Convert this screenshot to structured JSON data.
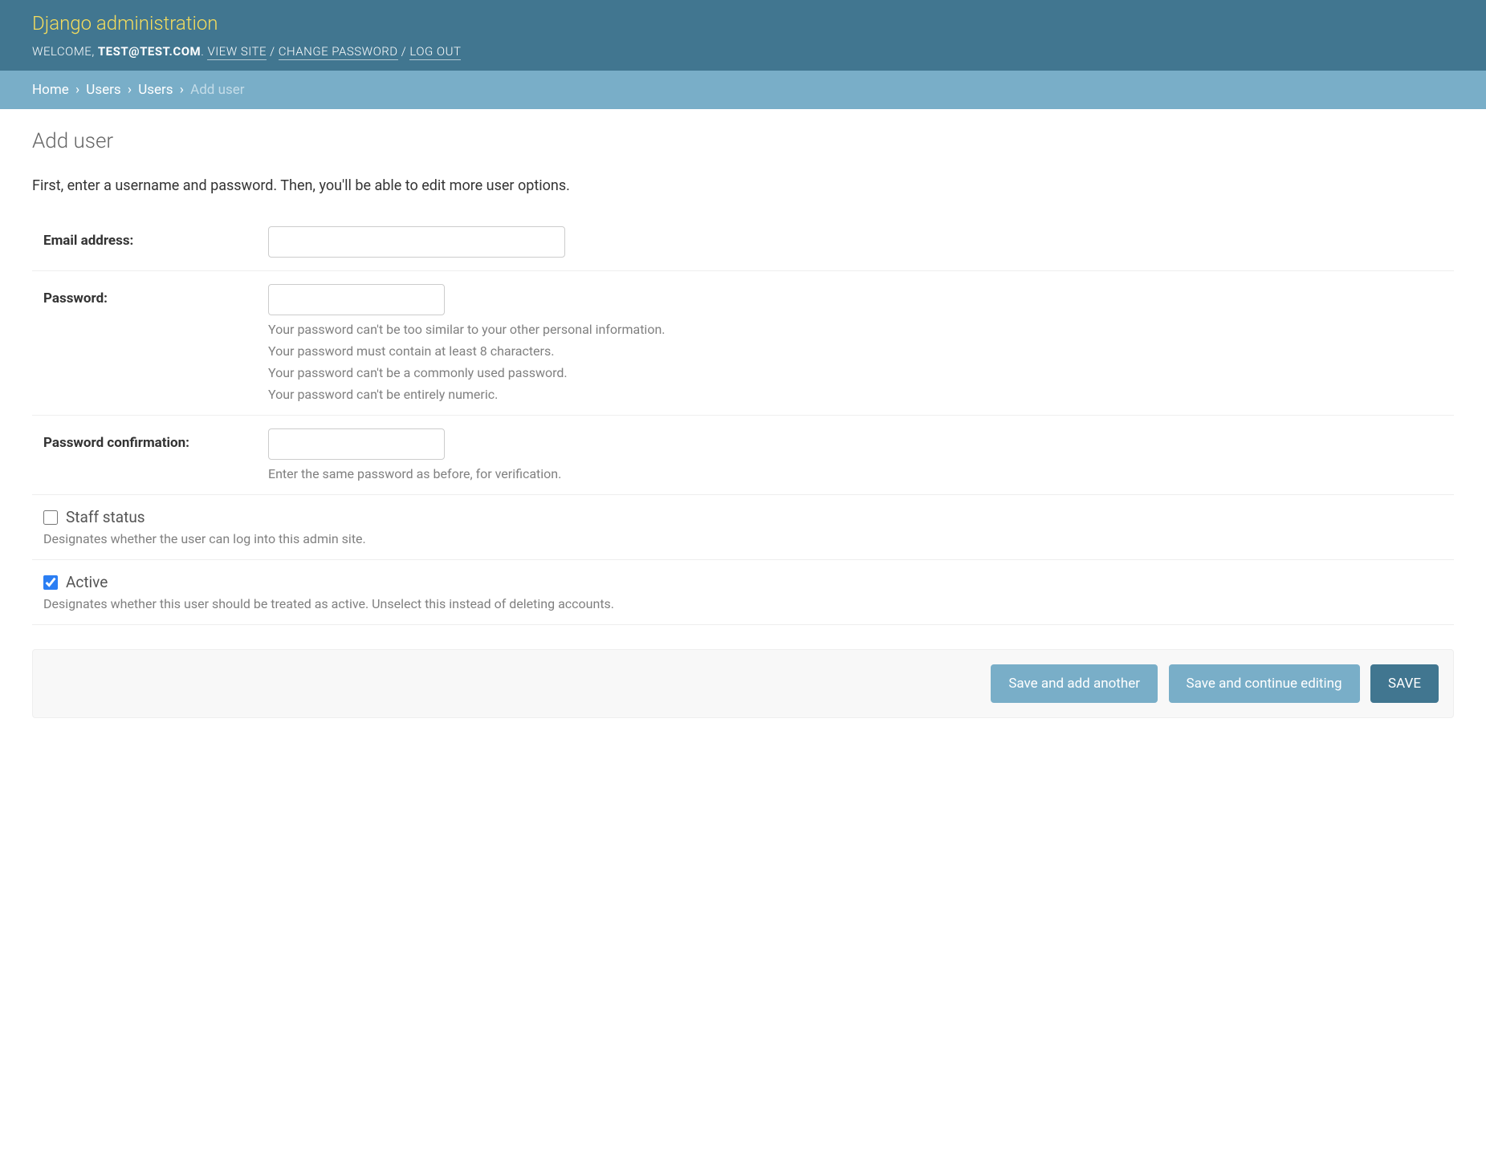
{
  "header": {
    "title": "Django administration",
    "welcome_prefix": "Welcome,",
    "user": "TEST@TEST.COM",
    "view_site": "View site",
    "change_password": "Change password",
    "log_out": "Log out"
  },
  "breadcrumbs": {
    "home": "Home",
    "app": "Users",
    "model": "Users",
    "current": "Add user"
  },
  "page": {
    "title": "Add user",
    "intro": "First, enter a username and password. Then, you'll be able to edit more user options."
  },
  "form": {
    "email": {
      "label": "Email address:",
      "value": ""
    },
    "password": {
      "label": "Password:",
      "value": "",
      "help": [
        "Your password can't be too similar to your other personal information.",
        "Your password must contain at least 8 characters.",
        "Your password can't be a commonly used password.",
        "Your password can't be entirely numeric."
      ]
    },
    "password_confirm": {
      "label": "Password confirmation:",
      "value": "",
      "help": "Enter the same password as before, for verification."
    },
    "staff_status": {
      "label": "Staff status",
      "checked": false,
      "help": "Designates whether the user can log into this admin site."
    },
    "active": {
      "label": "Active",
      "checked": true,
      "help": "Designates whether this user should be treated as active. Unselect this instead of deleting accounts."
    }
  },
  "actions": {
    "save_add_another": "Save and add another",
    "save_continue": "Save and continue editing",
    "save": "SAVE"
  }
}
